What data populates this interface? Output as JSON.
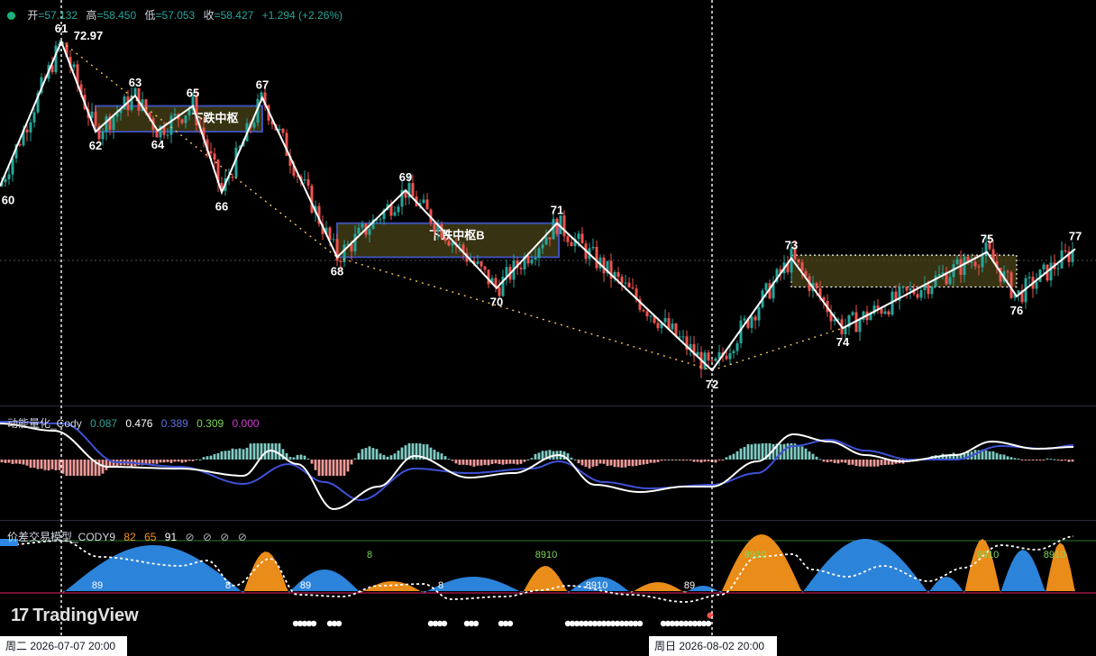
{
  "ohlc": {
    "open_label": "开",
    "open": "=57.132",
    "high_label": "高",
    "high": "=58.450",
    "low_label": "低",
    "low": "=57.053",
    "close_label": "收",
    "close": "=58.427",
    "change": "+1.294 (+2.26%)"
  },
  "indicator1": {
    "name": "动能量化_Cody",
    "values": [
      "0.087",
      "0.476",
      "0.389",
      "0.309",
      "0.000"
    ],
    "colors": [
      "#26a69a",
      "#ffffff",
      "#5b6ee1",
      "#7ed957",
      "#d63bd6"
    ]
  },
  "indicator2": {
    "name": "价差交易模型_CODY9",
    "values": [
      "82",
      "65",
      "91"
    ],
    "colors": [
      "#f7931a",
      "#f7931a",
      "#ffffff"
    ],
    "icons": [
      "⊘",
      "⊘",
      "⊘",
      "⊘"
    ]
  },
  "brand": {
    "name": "TradingView"
  },
  "time_labels": {
    "left": "周二 2026-07-07   20:00",
    "right": "周日 2026-08-02   20:00"
  },
  "chart_data": {
    "type": "candlestick",
    "zigzag_points": [
      {
        "label": "60",
        "price": 58.9
      },
      {
        "label": "61",
        "price": 72.97
      },
      {
        "label": "62",
        "price": 64.2
      },
      {
        "label": "63",
        "price": 67.7
      },
      {
        "label": "64",
        "price": 64.3
      },
      {
        "label": "65",
        "price": 66.7
      },
      {
        "label": "66",
        "price": 58.3
      },
      {
        "label": "67",
        "price": 67.5
      },
      {
        "label": "68",
        "price": 52.0
      },
      {
        "label": "69",
        "price": 58.5
      },
      {
        "label": "70",
        "price": 49.0
      },
      {
        "label": "71",
        "price": 55.3
      },
      {
        "label": "72",
        "price": 41.0
      },
      {
        "label": "73",
        "price": 51.9
      },
      {
        "label": "74",
        "price": 45.1
      },
      {
        "label": "75",
        "price": 52.5
      },
      {
        "label": "76",
        "price": 48.2
      },
      {
        "label": "77",
        "price": 52.8
      }
    ],
    "peak_price_label": "72.97",
    "zones": [
      {
        "label": "下跌中枢",
        "high": 66.7,
        "low": 64.2
      },
      {
        "label": "下跌中枢B",
        "high": 55.3,
        "low": 52.0
      },
      {
        "label": "",
        "high": 52.2,
        "low": 49.1
      }
    ],
    "panel1_series": [
      "histogram",
      "white line",
      "blue line"
    ],
    "panel2_labels": [
      "89",
      "8",
      "8",
      "89",
      "8",
      "8910",
      "8910",
      "89",
      "8910",
      "8910",
      "8910"
    ]
  }
}
